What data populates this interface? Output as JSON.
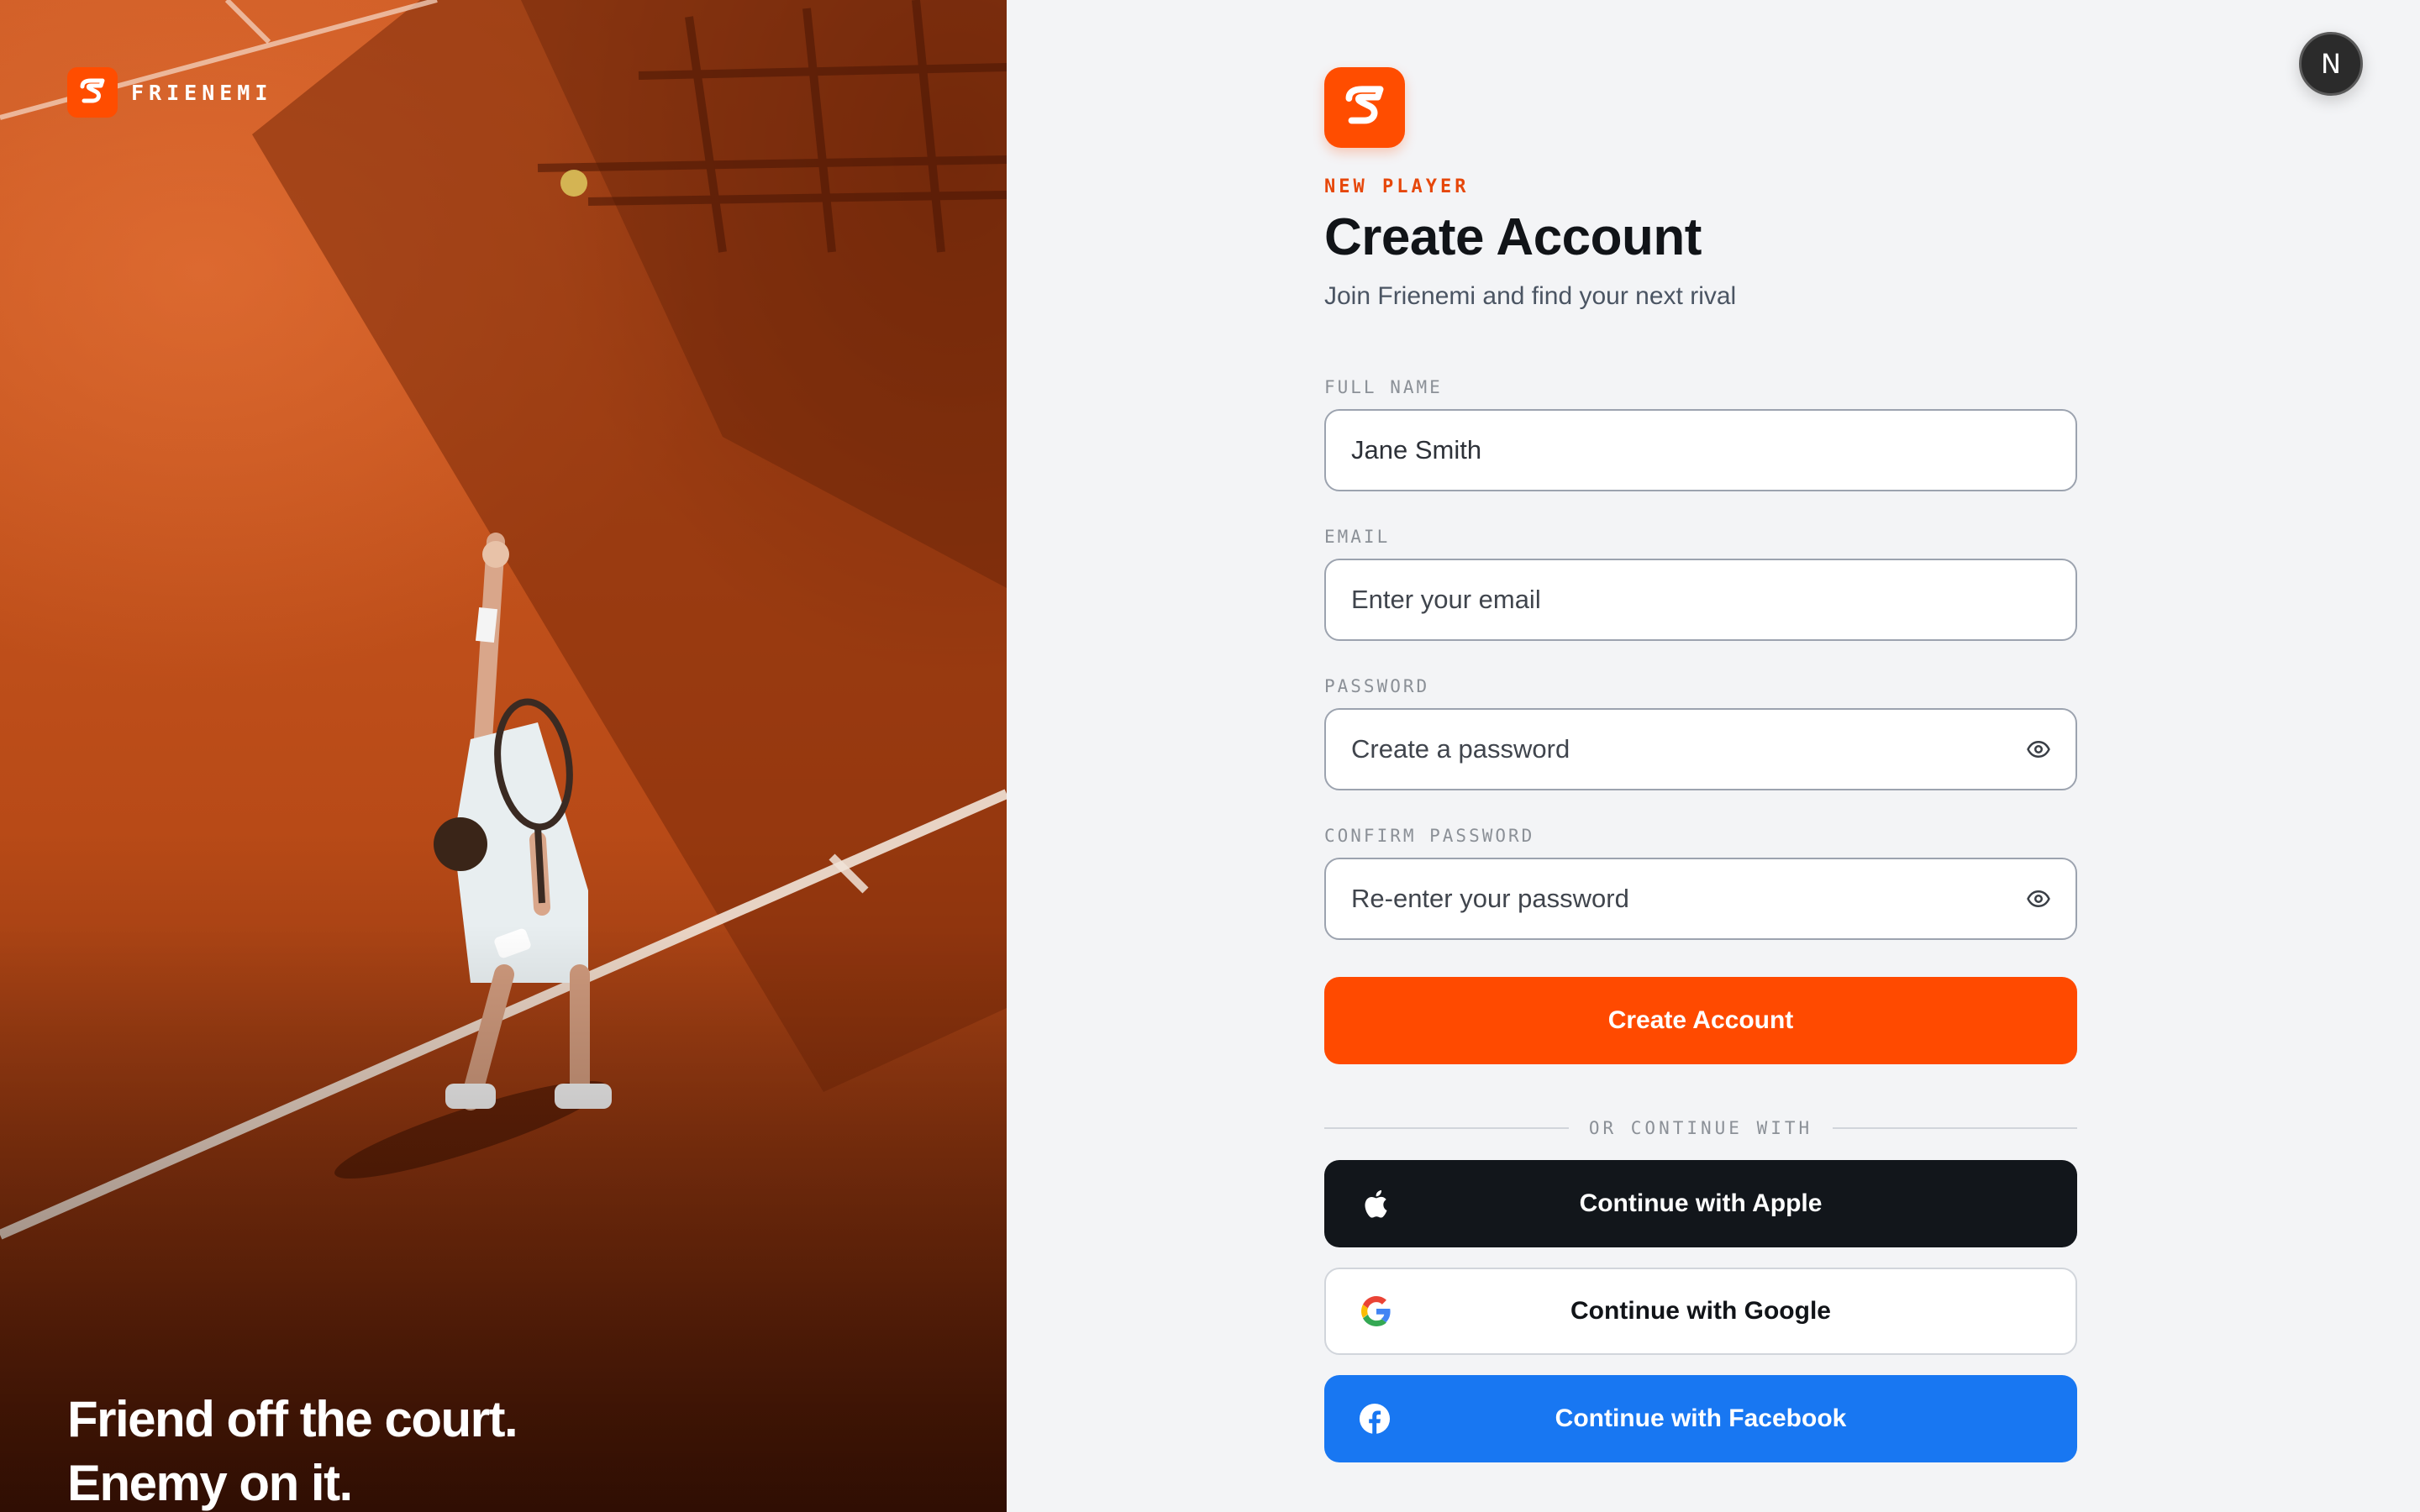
{
  "brand": {
    "name": "FRIENEMI",
    "accent_color": "#ff4d00"
  },
  "hero": {
    "tagline_line1": "Friend off the court.",
    "tagline_line2": "Enemy on it."
  },
  "avatar": {
    "initial": "N"
  },
  "form": {
    "eyebrow": "NEW PLAYER",
    "title": "Create Account",
    "subtitle": "Join Frienemi and find your next rival",
    "fields": {
      "full_name": {
        "label": "FULL NAME",
        "value": "Jane Smith",
        "placeholder": ""
      },
      "email": {
        "label": "EMAIL",
        "value": "",
        "placeholder": "Enter your email"
      },
      "password": {
        "label": "PASSWORD",
        "value": "",
        "placeholder": "Create a password",
        "icon": "eye-icon"
      },
      "confirm_password": {
        "label": "CONFIRM PASSWORD",
        "value": "",
        "placeholder": "Re-enter your password",
        "icon": "eye-icon"
      }
    },
    "submit_label": "Create Account",
    "divider_text": "OR CONTINUE WITH",
    "social": {
      "apple": {
        "label": "Continue with Apple",
        "icon": "apple-icon",
        "color": "#12161b"
      },
      "google": {
        "label": "Continue with Google",
        "icon": "google-icon",
        "color": "#ffffff"
      },
      "facebook": {
        "label": "Continue with Facebook",
        "icon": "facebook-icon",
        "color": "#1877f2"
      }
    }
  }
}
